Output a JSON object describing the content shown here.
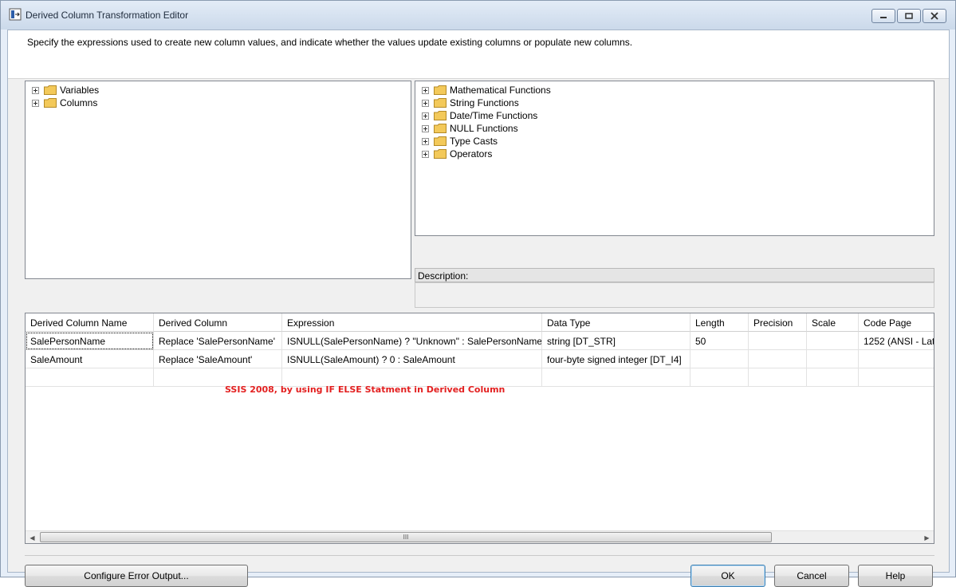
{
  "window": {
    "title": "Derived Column Transformation Editor"
  },
  "instruction": "Specify the expressions used to create new column values, and indicate whether the values update existing columns or populate new columns.",
  "left_tree": {
    "items": [
      {
        "label": "Variables"
      },
      {
        "label": "Columns"
      }
    ]
  },
  "right_tree": {
    "items": [
      {
        "label": "Mathematical Functions"
      },
      {
        "label": "String Functions"
      },
      {
        "label": "Date/Time Functions"
      },
      {
        "label": "NULL Functions"
      },
      {
        "label": "Type Casts"
      },
      {
        "label": "Operators"
      }
    ]
  },
  "description": {
    "label": "Description:"
  },
  "grid": {
    "headers": [
      "Derived Column Name",
      "Derived Column",
      "Expression",
      "Data Type",
      "Length",
      "Precision",
      "Scale",
      "Code Page"
    ],
    "rows": [
      [
        "SalePersonName",
        "Replace 'SalePersonName'",
        "ISNULL(SalePersonName) ? \"Unknown\" : SalePersonName",
        "string [DT_STR]",
        "50",
        "",
        "",
        "1252  (ANSI - Lat"
      ],
      [
        "SaleAmount",
        "Replace 'SaleAmount'",
        "ISNULL(SaleAmount) ? 0 : SaleAmount",
        "four-byte signed integer [DT_I4]",
        "",
        "",
        "",
        ""
      ],
      [
        "",
        "",
        "",
        "",
        "",
        "",
        "",
        ""
      ]
    ],
    "scroll_thumb_grip": "III"
  },
  "annotation": "SSIS 2008, by using IF ELSE Statment in Derived Column",
  "buttons": {
    "configure_error_output": "Configure Error Output...",
    "ok": "OK",
    "cancel": "Cancel",
    "help": "Help"
  },
  "colors": {
    "annotation": "#e32020",
    "folder": "#f3c95a",
    "window_frame": "#cbd9ea"
  }
}
